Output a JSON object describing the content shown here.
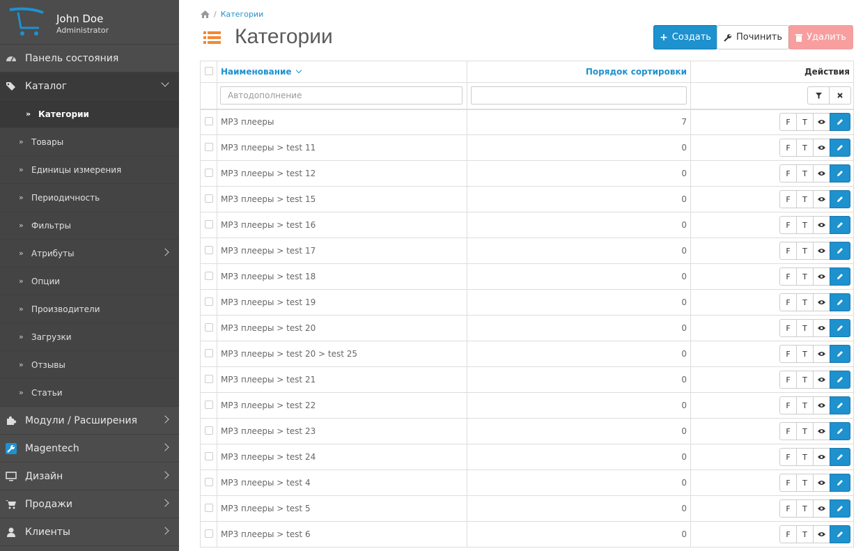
{
  "profile": {
    "name": "John Doe",
    "role": "Administrator"
  },
  "sidebar": {
    "top": [
      {
        "label": "Панель состояния"
      },
      {
        "label": "Каталог"
      }
    ],
    "catalog_sub": [
      {
        "label": "Категории"
      },
      {
        "label": "Товары"
      },
      {
        "label": "Единицы измерения"
      },
      {
        "label": "Периодичность"
      },
      {
        "label": "Фильтры"
      },
      {
        "label": "Атрибуты"
      },
      {
        "label": "Опции"
      },
      {
        "label": "Производители"
      },
      {
        "label": "Загрузки"
      },
      {
        "label": "Отзывы"
      },
      {
        "label": "Статьи"
      }
    ],
    "bottom": [
      {
        "label": "Модули / Расширения"
      },
      {
        "label": "Magentech"
      },
      {
        "label": "Дизайн"
      },
      {
        "label": "Продажи"
      },
      {
        "label": "Клиенты"
      }
    ]
  },
  "breadcrumb": {
    "current": "Категории"
  },
  "page": {
    "title": "Категории"
  },
  "toolbar": {
    "create": "Создать",
    "repair": "Починить",
    "delete": "Удалить"
  },
  "table": {
    "col_name": "Наименование",
    "col_sort": "Порядок сортировки",
    "col_actions": "Действия",
    "filter_placeholder": "Автодополнение",
    "action_labels": {
      "f": "F",
      "t": "T"
    },
    "rows": [
      {
        "name": "MP3 плееры",
        "sort": "7"
      },
      {
        "name": "MP3 плееры > test 11",
        "sort": "0"
      },
      {
        "name": "MP3 плееры > test 12",
        "sort": "0"
      },
      {
        "name": "MP3 плееры > test 15",
        "sort": "0"
      },
      {
        "name": "MP3 плееры > test 16",
        "sort": "0"
      },
      {
        "name": "MP3 плееры > test 17",
        "sort": "0"
      },
      {
        "name": "MP3 плееры > test 18",
        "sort": "0"
      },
      {
        "name": "MP3 плееры > test 19",
        "sort": "0"
      },
      {
        "name": "MP3 плееры > test 20",
        "sort": "0"
      },
      {
        "name": "MP3 плееры > test 20 > test 25",
        "sort": "0"
      },
      {
        "name": "MP3 плееры > test 21",
        "sort": "0"
      },
      {
        "name": "MP3 плееры > test 22",
        "sort": "0"
      },
      {
        "name": "MP3 плееры > test 23",
        "sort": "0"
      },
      {
        "name": "MP3 плееры > test 24",
        "sort": "0"
      },
      {
        "name": "MP3 плееры > test 4",
        "sort": "0"
      },
      {
        "name": "MP3 плееры > test 5",
        "sort": "0"
      },
      {
        "name": "MP3 плееры > test 6",
        "sort": "0"
      }
    ]
  },
  "colors": {
    "accent": "#1e91cf",
    "sidebar": "#4c4c4c",
    "danger": "#f56b6b",
    "title_icon": "#f38733"
  }
}
